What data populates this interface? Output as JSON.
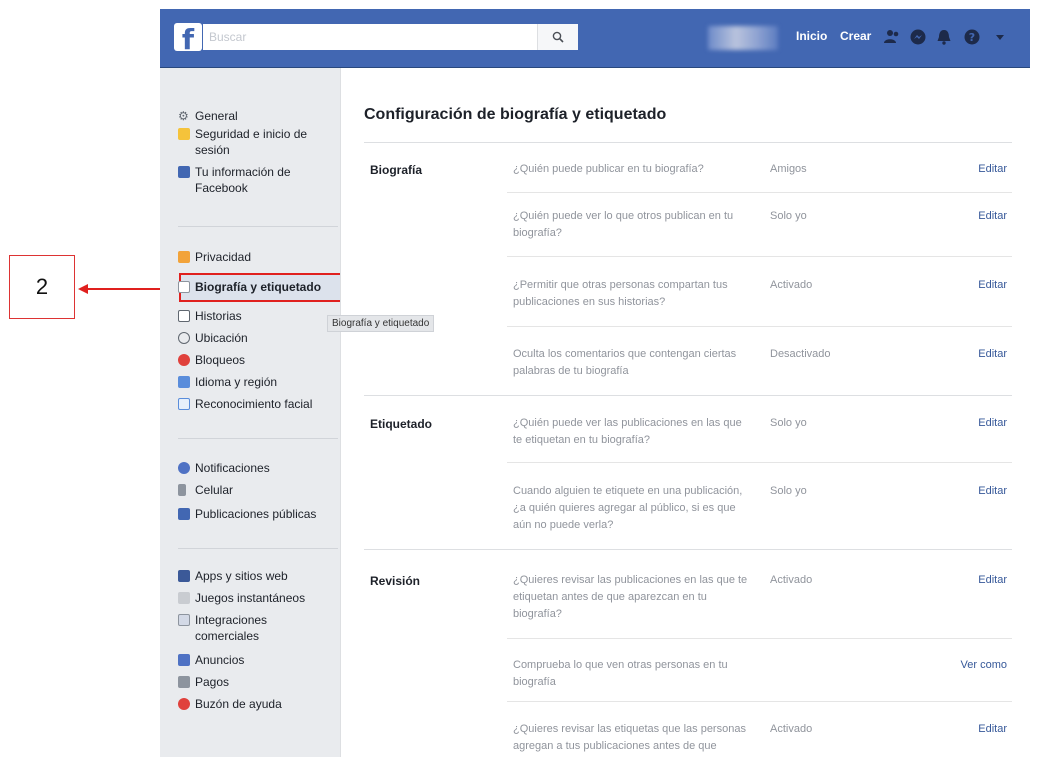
{
  "annotation": {
    "step_number": "2",
    "color": "#e0201e"
  },
  "topbar": {
    "logo": "f",
    "search_placeholder": "Buscar",
    "search_icon": "search-icon",
    "nav": {
      "home": "Inicio",
      "create": "Crear"
    },
    "icons": [
      "friends-icon",
      "messenger-icon",
      "notifications-icon",
      "help-icon",
      "chevron-down-icon"
    ],
    "bg_color": "#4267b2"
  },
  "sidebar": {
    "groups": [
      [
        {
          "label": "General",
          "icon": "gear-icon"
        },
        {
          "label": "Seguridad e inicio de sesión",
          "icon": "shield-icon"
        },
        {
          "label": "Tu información de Facebook",
          "icon": "facebook-icon"
        }
      ],
      [
        {
          "label": "Privacidad",
          "icon": "lock-icon"
        },
        {
          "label": "Biografía y etiquetado",
          "icon": "timeline-icon",
          "selected": true
        },
        {
          "label": "Historias",
          "icon": "book-icon"
        },
        {
          "label": "Ubicación",
          "icon": "location-icon"
        },
        {
          "label": "Bloqueos",
          "icon": "block-icon"
        },
        {
          "label": "Idioma y región",
          "icon": "language-icon"
        },
        {
          "label": "Reconocimiento facial",
          "icon": "face-icon"
        }
      ],
      [
        {
          "label": "Notificaciones",
          "icon": "globe-icon"
        },
        {
          "label": "Celular",
          "icon": "phone-icon"
        },
        {
          "label": "Publicaciones públicas",
          "icon": "rss-icon"
        }
      ],
      [
        {
          "label": "Apps y sitios web",
          "icon": "apps-icon"
        },
        {
          "label": "Juegos instantáneos",
          "icon": "gamepad-icon"
        },
        {
          "label": "Integraciones comerciales",
          "icon": "integrations-icon"
        },
        {
          "label": "Anuncios",
          "icon": "ads-icon"
        },
        {
          "label": "Pagos",
          "icon": "card-icon"
        },
        {
          "label": "Buzón de ayuda",
          "icon": "lifebuoy-icon"
        }
      ]
    ],
    "tooltip": "Biografía y etiquetado"
  },
  "main": {
    "title": "Configuración de biografía y etiquetado",
    "sections": [
      {
        "label": "Biografía",
        "rows": [
          {
            "question": "¿Quién puede publicar en tu biografía?",
            "value": "Amigos",
            "action": "Editar"
          },
          {
            "question": "¿Quién puede ver lo que otros publican en tu biografía?",
            "value": "Solo yo",
            "action": "Editar"
          },
          {
            "question": "¿Permitir que otras personas compartan tus publicaciones en sus historias?",
            "value": "Activado",
            "action": "Editar"
          },
          {
            "question": "Oculta los comentarios que contengan ciertas palabras de tu biografía",
            "value": "Desactivado",
            "action": "Editar"
          }
        ]
      },
      {
        "label": "Etiquetado",
        "rows": [
          {
            "question": "¿Quién puede ver las publicaciones en las que te etiquetan en tu biografía?",
            "value": "Solo yo",
            "action": "Editar"
          },
          {
            "question": "Cuando alguien te etiquete en una publicación, ¿a quién quieres agregar al público, si es que aún no puede verla?",
            "value": "Solo yo",
            "action": "Editar"
          }
        ]
      },
      {
        "label": "Revisión",
        "rows": [
          {
            "question": "¿Quieres revisar las publicaciones en las que te etiquetan antes de que aparezcan en tu biografía?",
            "value": "Activado",
            "action": "Editar"
          },
          {
            "question": "Comprueba lo que ven otras personas en tu biografía",
            "value": "",
            "action": "Ver como"
          },
          {
            "question": "¿Quieres revisar las etiquetas que las personas agregan a tus publicaciones antes de que",
            "value": "Activado",
            "action": "Editar"
          }
        ]
      }
    ]
  }
}
